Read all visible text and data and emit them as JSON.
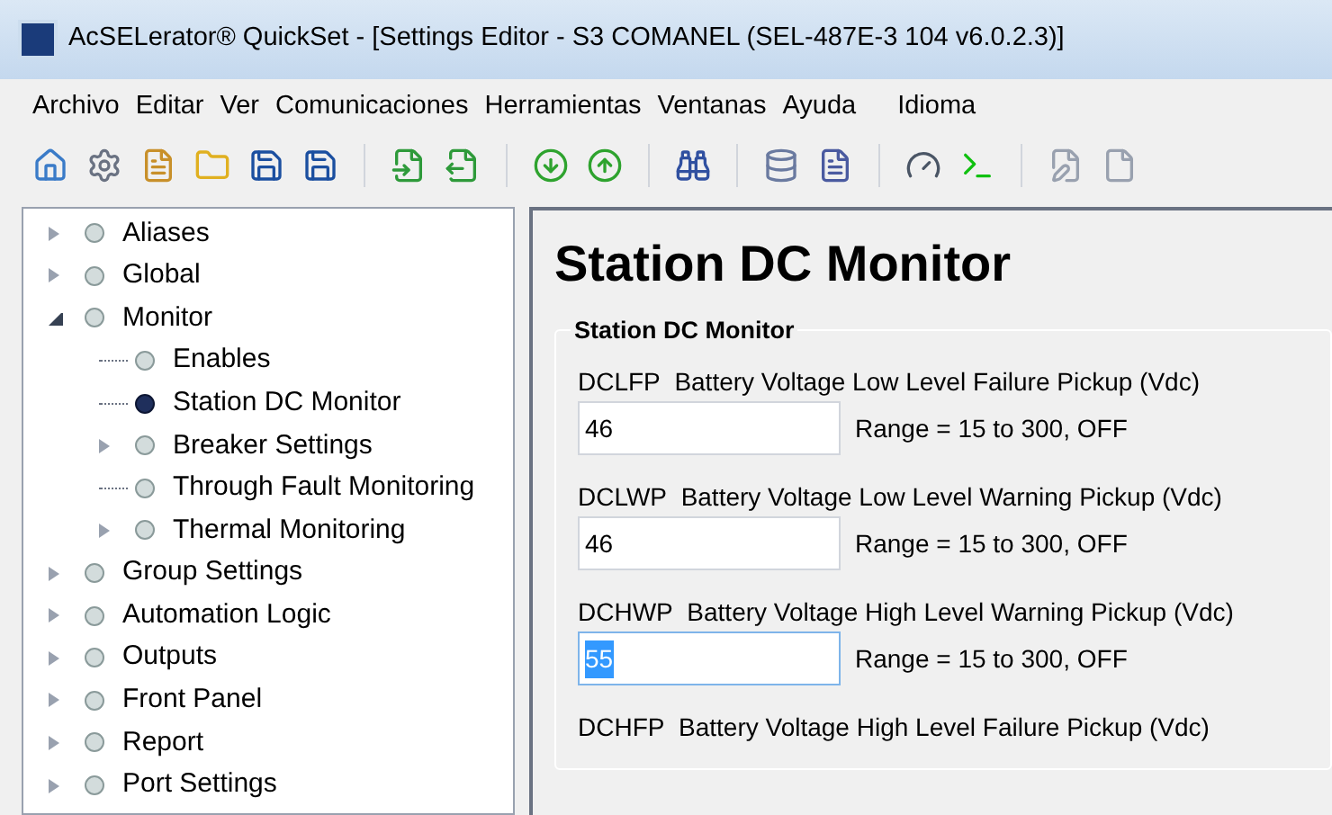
{
  "window": {
    "title": "AcSELerator® QuickSet - [Settings Editor - S3 COMANEL (SEL-487E-3 104 v6.0.2.3)]"
  },
  "menu": [
    "Archivo",
    "Editar",
    "Ver",
    "Comunicaciones",
    "Herramientas",
    "Ventanas",
    "Ayuda",
    "Idioma"
  ],
  "tree": [
    {
      "label": "Aliases",
      "selected": false,
      "expanded": false
    },
    {
      "label": "Global",
      "selected": false,
      "expanded": false
    },
    {
      "label": "Monitor",
      "selected": false,
      "expanded": true,
      "children": [
        {
          "label": "Enables",
          "selected": false
        },
        {
          "label": "Station DC Monitor",
          "selected": true
        },
        {
          "label": "Breaker Settings",
          "selected": false,
          "expanded": false
        },
        {
          "label": "Through Fault Monitoring",
          "selected": false
        },
        {
          "label": "Thermal Monitoring",
          "selected": false,
          "expanded": false
        }
      ]
    },
    {
      "label": "Group Settings",
      "selected": false,
      "expanded": false
    },
    {
      "label": "Automation Logic",
      "selected": false,
      "expanded": false
    },
    {
      "label": "Outputs",
      "selected": false,
      "expanded": false
    },
    {
      "label": "Front Panel",
      "selected": false,
      "expanded": false
    },
    {
      "label": "Report",
      "selected": false,
      "expanded": false
    },
    {
      "label": "Port Settings",
      "selected": false,
      "expanded": false
    }
  ],
  "page": {
    "title": "Station DC Monitor",
    "group_title": "Station DC Monitor",
    "settings": [
      {
        "code": "DCLFP",
        "label": "Battery Voltage Low Level Failure Pickup (Vdc)",
        "value": "46",
        "range": "Range = 15 to 300, OFF",
        "selected": false
      },
      {
        "code": "DCLWP",
        "label": "Battery Voltage Low Level Warning Pickup (Vdc)",
        "value": "46",
        "range": "Range = 15 to 300, OFF",
        "selected": false
      },
      {
        "code": "DCHWP",
        "label": "Battery Voltage High Level Warning Pickup (Vdc)",
        "value": "55",
        "range": "Range = 15 to 300, OFF",
        "selected": true
      },
      {
        "code": "DCHFP",
        "label": "Battery Voltage High Level Failure Pickup (Vdc)"
      }
    ]
  }
}
